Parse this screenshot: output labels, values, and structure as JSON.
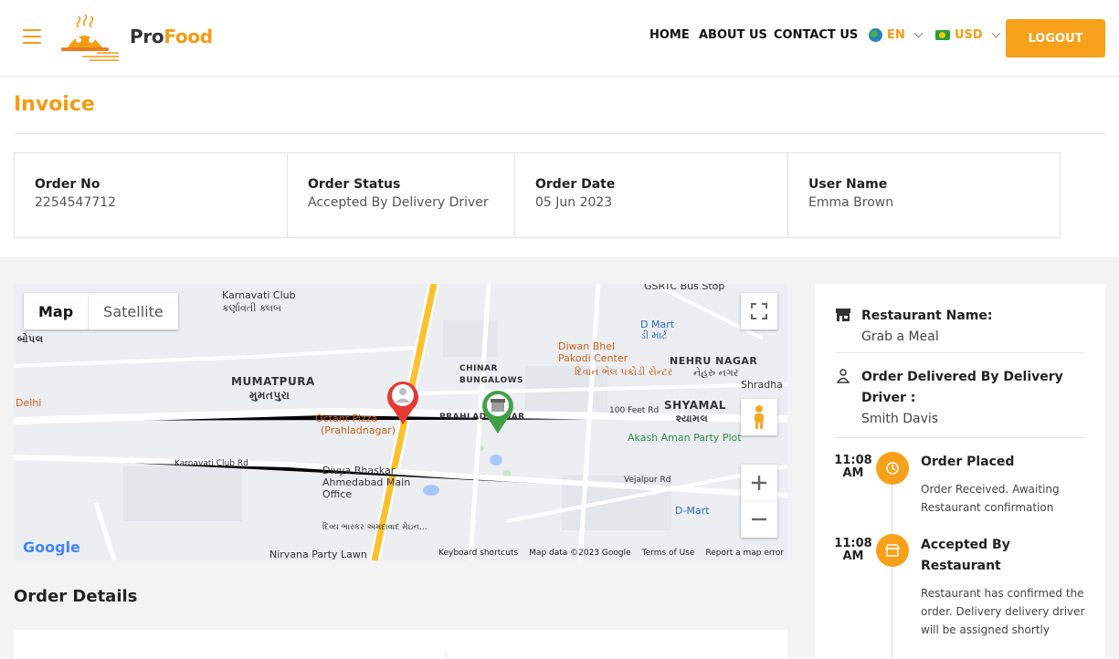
{
  "header": {
    "logo_pro": "Pro",
    "logo_food": "Food",
    "nav": [
      "HOME",
      "ABOUT US",
      "CONTACT US"
    ],
    "language": "EN",
    "currency": "USD",
    "logout_label": "LOGOUT"
  },
  "invoice": {
    "title": "Invoice",
    "fields": [
      {
        "label": "Order No",
        "value": "2254547712"
      },
      {
        "label": "Order Status",
        "value": "Accepted By Delivery Driver"
      },
      {
        "label": "Order Date",
        "value": "05 Jun 2023"
      },
      {
        "label": "User Name",
        "value": "Emma Brown"
      }
    ]
  },
  "map": {
    "btn_map": "Map",
    "btn_satellite": "Satellite",
    "labels": [
      "Karnavati Club",
      "કર્ણાવતી ક્લબ",
      "GSRTC Bus Stop",
      "D Mart",
      "ડી માર્ટ",
      "Diwan Bhel Pakodi Center",
      "દિવાન ભેલ પકોડી સેન્ટર",
      "NEHRU NAGAR",
      "નેહરુ નગર",
      "MUMATPURA",
      "મુમતપુરા",
      "CHINAR BUNGALOWS",
      "PRAHLAD NAGAR",
      "SHYAMAL",
      "શ્યામલ",
      "Octant Pizza",
      "(Prahladnagar)",
      "100 Feet Rd",
      "Akash Aman Party Plot",
      "Delhi",
      "Karnavati Club Rd",
      "Divya Bhaskar Ahmedabad Main Office",
      "દિવ્ય ભાસ્કર અમદાવાદ મેઇન...",
      "Vejalpur Rd",
      "D-Mart",
      "Nirvana Party Lawn",
      "Shradha",
      "બોપલ"
    ],
    "footer": [
      "Keyboard shortcuts",
      "Map data ©2023 Google",
      "Terms of Use",
      "Report a map error"
    ],
    "google": "Google"
  },
  "order_details_title": "Order Details",
  "panel": {
    "restaurant_label": "Restaurant Name:",
    "restaurant_value": "Grab a Meal",
    "driver_label": "Order Delivered By Delivery Driver :",
    "driver_value": "Smith Davis",
    "timeline": [
      {
        "time": "11:08 AM",
        "title": "Order Placed",
        "desc": "Order Received. Awaiting Restaurant confirmation"
      },
      {
        "time": "11:08 AM",
        "title": "Accepted By Restaurant",
        "desc": "Restaurant has confirmed the order. Delivery delivery driver will be assigned shortly"
      }
    ]
  },
  "colors": {
    "accent": "#f7a01a",
    "title": "#f39c12",
    "marker_red": "#e53935",
    "marker_green": "#43a047"
  }
}
